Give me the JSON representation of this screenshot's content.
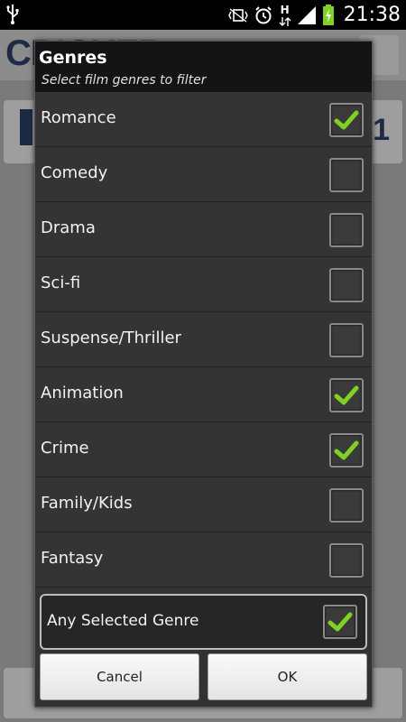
{
  "status_bar": {
    "time": "21:38",
    "icons": [
      "usb-icon",
      "vibrate-icon",
      "alarm-icon",
      "hspa-data-icon",
      "signal-icon",
      "battery-charging-icon"
    ],
    "network_label": "H"
  },
  "background_app": {
    "logo_text": "CRICKER",
    "card_number": "1"
  },
  "dialog": {
    "title": "Genres",
    "subtitle": "Select film genres to filter",
    "genres": [
      {
        "label": "Romance",
        "checked": true
      },
      {
        "label": "Comedy",
        "checked": false
      },
      {
        "label": "Drama",
        "checked": false
      },
      {
        "label": "Sci-fi",
        "checked": false
      },
      {
        "label": "Suspense/Thriller",
        "checked": false
      },
      {
        "label": "Animation",
        "checked": true
      },
      {
        "label": "Crime",
        "checked": true
      },
      {
        "label": "Family/Kids",
        "checked": false
      },
      {
        "label": "Fantasy",
        "checked": false
      }
    ],
    "any_selected": {
      "label": "Any Selected Genre",
      "checked": true
    },
    "cancel_label": "Cancel",
    "ok_label": "OK"
  },
  "colors": {
    "check_green": "#7ed321",
    "dialog_bg": "#323232",
    "header_bg": "#141414"
  }
}
